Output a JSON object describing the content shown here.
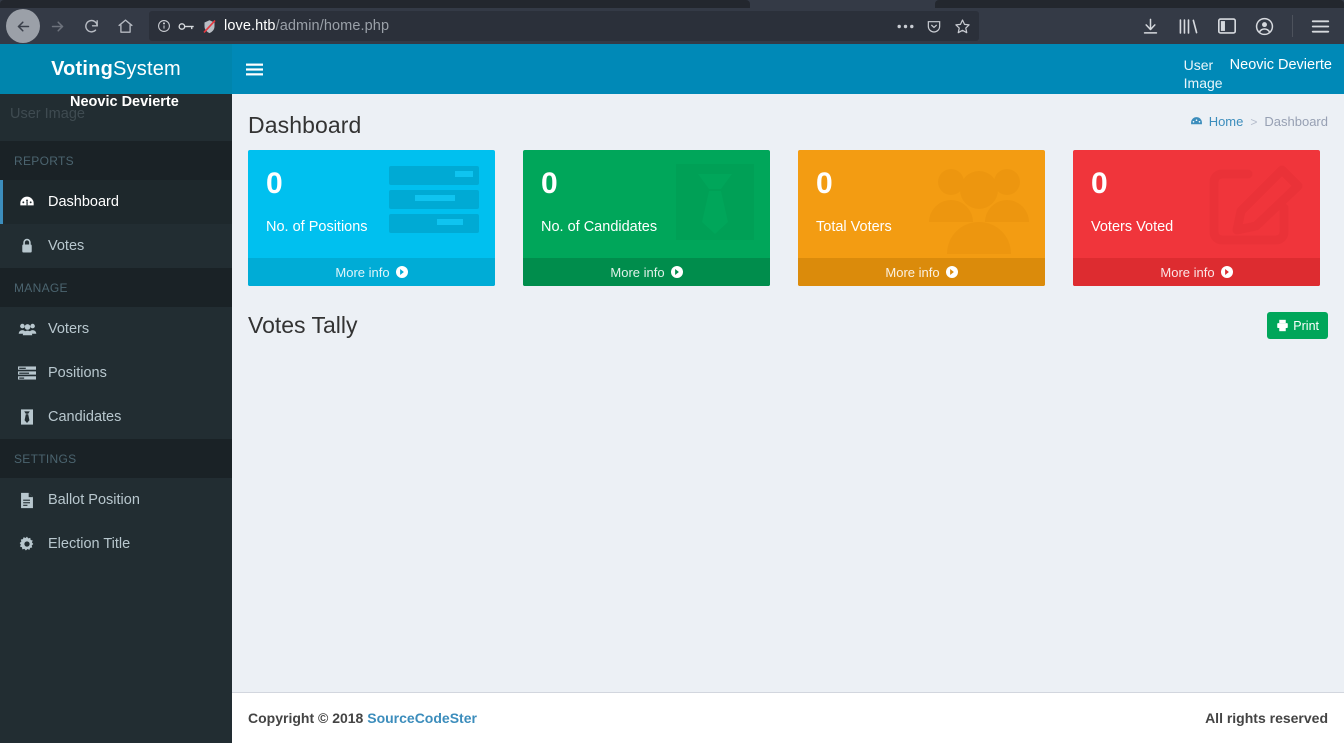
{
  "browser": {
    "url_host": "love.htb",
    "url_path": "/admin/home.php",
    "nav": {
      "back": "back-arrow",
      "forward": "forward-arrow",
      "reload": "reload",
      "home": "home"
    },
    "urlbar_icons": [
      "info-icon",
      "key-icon",
      "broken-shield-icon"
    ],
    "urlbar_right_icons": [
      "page-actions-ellipsis",
      "pocket-icon",
      "bookmark-star-icon"
    ],
    "toolbar_icons": [
      "downloads-icon",
      "library-icon",
      "sidebar-icon",
      "account-icon",
      "menu-icon"
    ]
  },
  "sidebar": {
    "brand_bold": "Voting",
    "brand_light": "System",
    "user": {
      "image_alt": "User Image",
      "name": "Neovic Devierte"
    },
    "sections": [
      {
        "header": "REPORTS",
        "items": [
          {
            "label": "Dashboard",
            "icon": "dashboard-icon",
            "active": true
          },
          {
            "label": "Votes",
            "icon": "lock-icon",
            "active": false
          }
        ]
      },
      {
        "header": "MANAGE",
        "items": [
          {
            "label": "Voters",
            "icon": "users-icon",
            "active": false
          },
          {
            "label": "Positions",
            "icon": "list-alt-icon",
            "active": false
          },
          {
            "label": "Candidates",
            "icon": "tie-icon",
            "active": false
          }
        ]
      },
      {
        "header": "SETTINGS",
        "items": [
          {
            "label": "Ballot Position",
            "icon": "file-text-icon",
            "active": false
          },
          {
            "label": "Election Title",
            "icon": "gear-icon",
            "active": false
          }
        ]
      }
    ]
  },
  "navbar": {
    "toggle_icon": "hamburger-icon",
    "user_image_alt": "User Image",
    "user_name": "Neovic Devierte"
  },
  "page": {
    "title": "Dashboard",
    "breadcrumb": {
      "home": "Home",
      "separator": ">",
      "current": "Dashboard",
      "home_icon": "dashboard-icon"
    },
    "info_boxes": [
      {
        "number": "0",
        "label": "No. of Positions",
        "more": "More info",
        "icon": "list-alt-icon",
        "color": "#00c0ef"
      },
      {
        "number": "0",
        "label": "No. of Candidates",
        "more": "More info",
        "icon": "tie-icon",
        "color": "#00a65a"
      },
      {
        "number": "0",
        "label": "Total Voters",
        "more": "More info",
        "icon": "users-icon",
        "color": "#f39c12"
      },
      {
        "number": "0",
        "label": "Voters Voted",
        "more": "More info",
        "icon": "edit-icon",
        "color": "#f0353b"
      }
    ],
    "tally": {
      "title": "Votes Tally",
      "print_label": "Print",
      "print_icon": "print-icon"
    }
  },
  "footer": {
    "copyright_prefix": "Copyright © 2018",
    "brand": "SourceCodeSter",
    "rights": "All rights reserved"
  }
}
